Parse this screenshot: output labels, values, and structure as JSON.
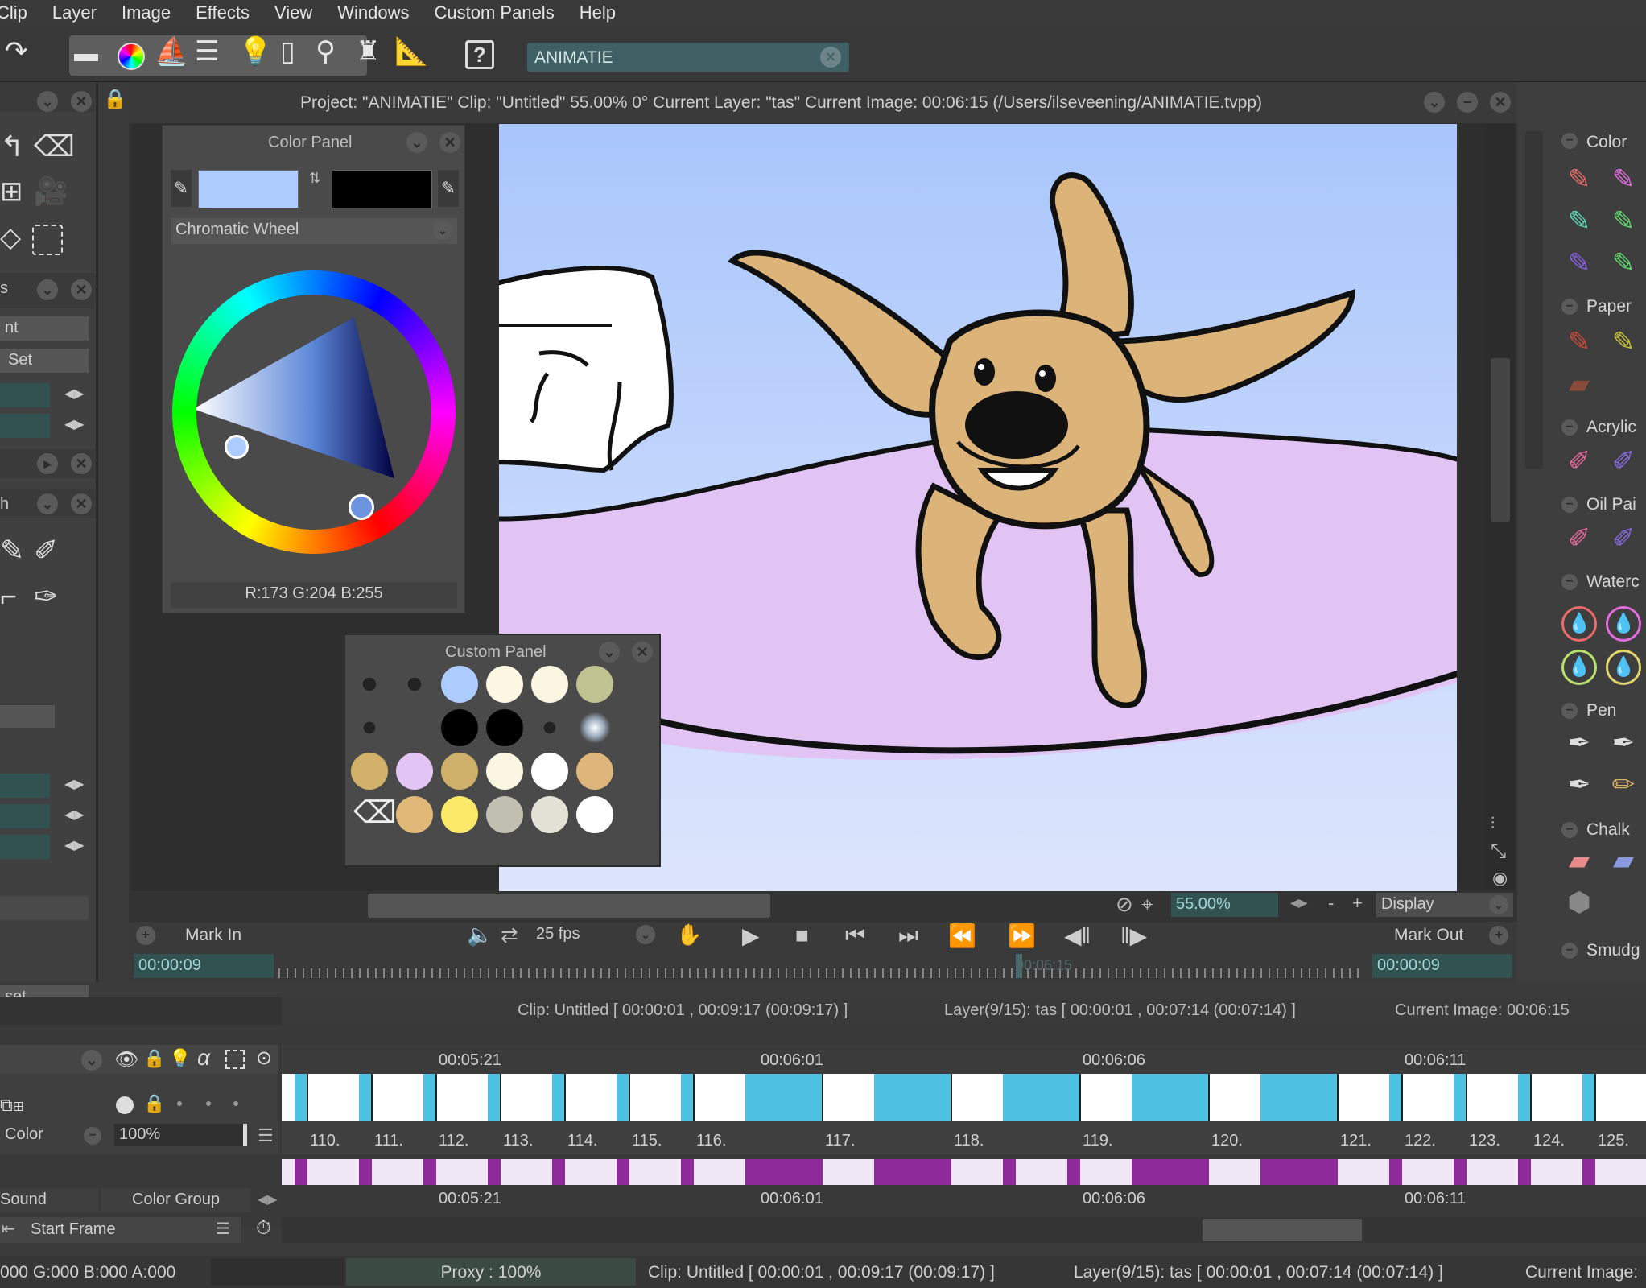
{
  "menu": [
    "Clip",
    "Layer",
    "Image",
    "Effects",
    "View",
    "Windows",
    "Custom Panels",
    "Help"
  ],
  "toolbar": {
    "search_value": "ANIMATIE",
    "icons": [
      "redo-icon",
      "toolbox-icon",
      "color-wheel-icon",
      "brush-settings-icon",
      "layers-icon",
      "lightbulb-icon",
      "timeline-icon",
      "magnifier-icon",
      "stamp-icon",
      "ruler-icon",
      "help-icon"
    ]
  },
  "left_panel": {
    "labels": [
      "nt",
      "Set",
      "h",
      "set"
    ],
    "section_letter": "s"
  },
  "window": {
    "title": "Project:  \"ANIMATIE\"  Clip: \"Untitled\"   55.00%   0°  Current Layer: \"tas\"  Current Image: 00:06:15 (/Users/ilseveening/ANIMATIE.tvpp)"
  },
  "color_panel": {
    "title": "Color Panel",
    "mode": "Chromatic Wheel",
    "rgb_readout": "R:173 G:204 B:255",
    "primary_color": "#adccff",
    "secondary_color": "#000000"
  },
  "custom_panel": {
    "title": "Custom Panel",
    "swatches": [
      [
        "brush",
        "brush",
        "#adccff",
        "#fdf7e3",
        "#fbf6e2",
        "#c1c292"
      ],
      [
        "brush",
        "",
        "#000000",
        "#000000",
        "brush",
        "glow"
      ],
      [
        "#d2b26b",
        "#e2c5f5",
        "#cfb06a",
        "#fbf6e2",
        "#ffffff",
        "#deb57a"
      ],
      [
        "eraser",
        "#e0b878",
        "#fce96a",
        "#c0bfb0",
        "#e3e2d6",
        "#ffffff"
      ]
    ]
  },
  "right_panel": {
    "heads": [
      "Color",
      "Paper",
      "Acrylic",
      "Oil Pai",
      "Waterc",
      "Pen",
      "Chalk",
      "Smudg"
    ]
  },
  "view_controls": {
    "zoom": "55.00%",
    "display": "Display",
    "minus": "-",
    "plus": "+"
  },
  "transport": {
    "mark_in": "Mark In",
    "mark_out": "Mark Out",
    "fps": "25 fps",
    "timecode_in": "00:00:09",
    "timecode_out": "00:00:09",
    "ghost_time": "00:06:15"
  },
  "info_bar": {
    "clip": "Clip: Untitled [ 00:00:01 , 00:09:17  (00:09:17) ]",
    "layer": "Layer(9/15): tas [ 00:00:01 , 00:07:14  (00:07:14) ]",
    "current_image": "Current Image: 00:06:15"
  },
  "timeline": {
    "time_marks": [
      "00:05:21",
      "00:06:01",
      "00:06:06",
      "00:06:11"
    ],
    "frame_numbers": [
      "110.",
      "111.",
      "112.",
      "113.",
      "114.",
      "115.",
      "116.",
      "117.",
      "118.",
      "119.",
      "120.",
      "121.",
      "122.",
      "123.",
      "124.",
      "125."
    ],
    "layer_label": "Color",
    "opacity": "100%",
    "sound_tab": "Sound",
    "color_group_tab": "Color Group",
    "start_frame": "Start Frame"
  },
  "status_bar": {
    "rgba": "000 G:000 B:000 A:000",
    "proxy": "Proxy : 100%",
    "clip": "Clip: Untitled [ 00:00:01 , 00:09:17  (00:09:17) ]",
    "layer": "Layer(9/15): tas [ 00:00:01 , 00:07:14  (00:07:14) ]",
    "current_image": "Current Image:"
  },
  "colors": {
    "accent_teal": "#325252",
    "exposure_blue": "#4fc2e3",
    "exposure_purple": "#8e2a9a",
    "sky_blue": "#adccff",
    "floor_lilac": "#e1c4f3",
    "dog_tan": "#dcb47a"
  }
}
